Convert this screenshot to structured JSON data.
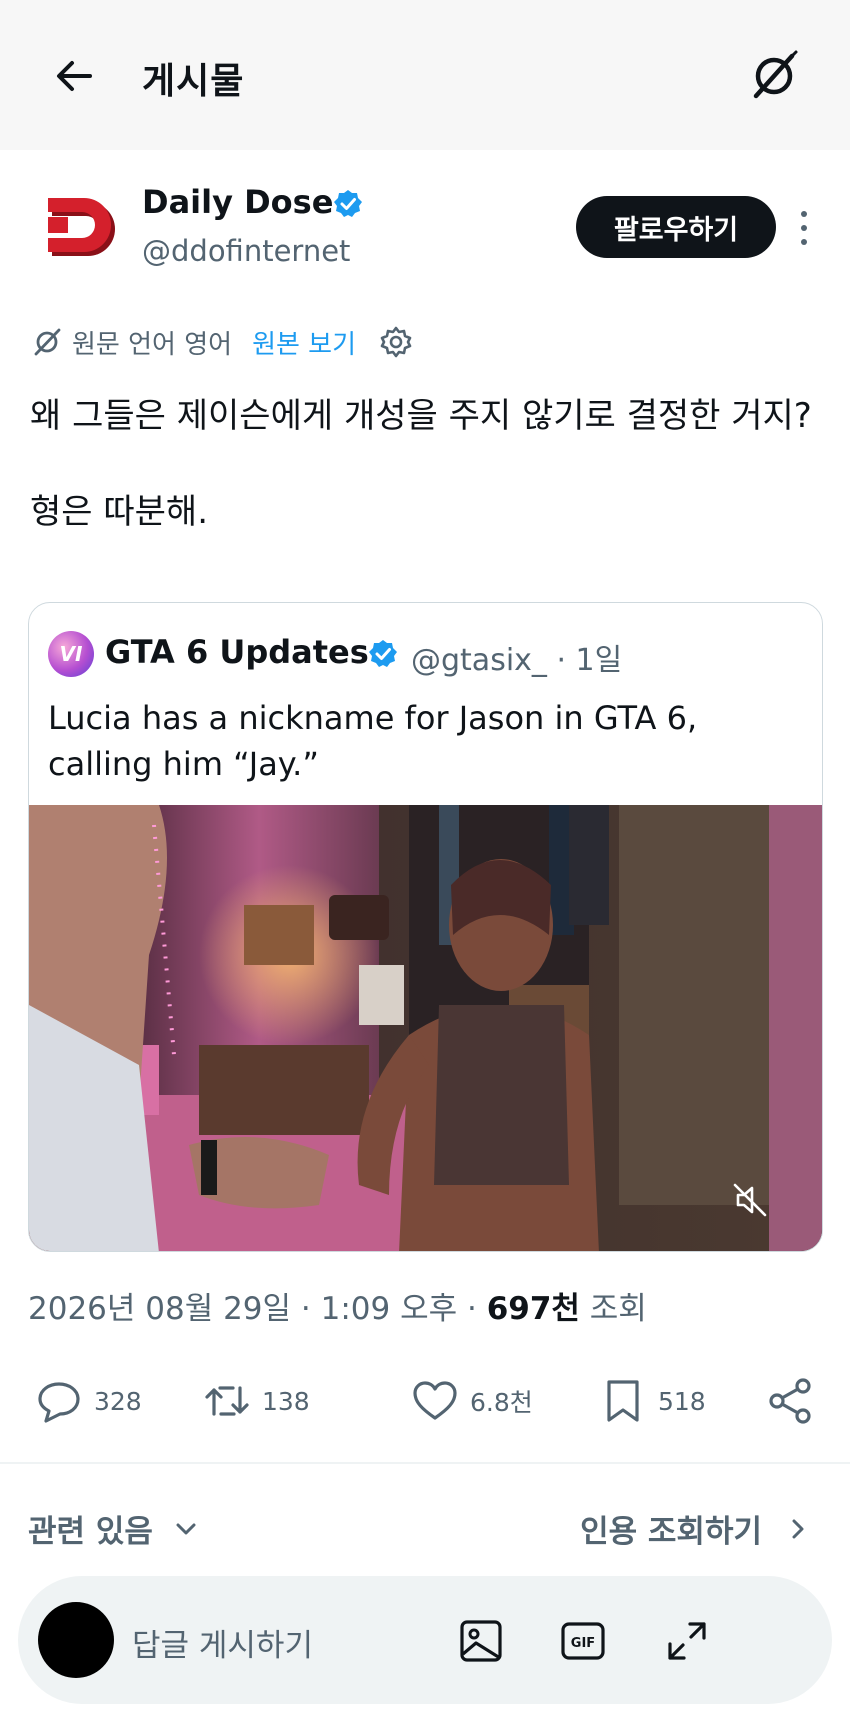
{
  "header": {
    "title": "게시물"
  },
  "post": {
    "author_name": "Daily Dose",
    "author_handle": "@ddofinternet",
    "follow_label": "팔로우하기",
    "translation": {
      "label": "원문 언어 영어",
      "show_original": "원본 보기"
    },
    "text_lines": [
      "왜 그들은 제이슨에게 개성을 주지 않기로 결정한 거지?",
      "형은 따분해."
    ],
    "quote": {
      "avatar_text": "VI",
      "author_name": "GTA 6 Updates",
      "handle_time": "@gtasix_ · 1일",
      "text": "Lucia has a nickname for Jason in GTA 6, calling him “Jay.”"
    },
    "meta": {
      "datetime": "2026년 08월 29일 · 1:09 오후 · ",
      "views_value": "697천",
      "views_label": " 조회"
    },
    "stats": {
      "replies": "328",
      "reposts": "138",
      "likes": "6.8천",
      "bookmarks": "518"
    }
  },
  "related": {
    "label": "관련 있음",
    "quotes_link": "인용 조회하기"
  },
  "reply": {
    "placeholder": "답글 게시하기"
  },
  "colors": {
    "accent": "#1d9bf0",
    "text": "#0f1419",
    "secondary": "#536471",
    "logo_red": "#d4202c"
  }
}
